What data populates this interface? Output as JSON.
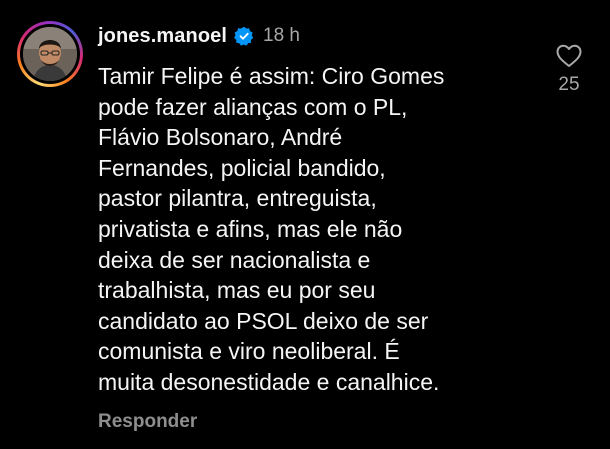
{
  "comment": {
    "username": "jones.manoel",
    "verified": true,
    "timestamp": "18 h",
    "text": "Tamir Felipe é assim: Ciro Gomes\npode fazer alianças com o PL,\nFlávio Bolsonaro, André\nFernandes, policial bandido,\npastor pilantra, entreguista,\nprivatista e afins, mas ele não\ndeixa de ser nacionalista e\ntrabalhista, mas eu por seu\ncandidato ao PSOL deixo de ser\ncomunista e viro neoliberal. É\nmuita desonestidade e canalhice.",
    "reply_label": "Responder",
    "like_count": "25"
  },
  "icons": {
    "verified": "verified-badge-icon",
    "like": "heart-outline-icon"
  },
  "colors": {
    "background": "#000000",
    "text": "#f5f5f5",
    "secondary": "#a8a8a8",
    "verified_badge": "#0095f6"
  }
}
